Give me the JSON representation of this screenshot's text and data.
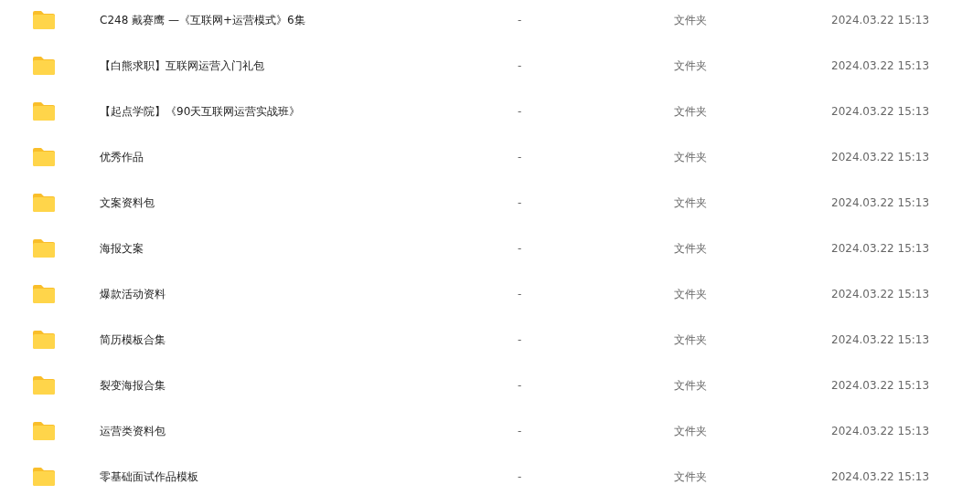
{
  "files": [
    {
      "name": "C248 戴赛鹰 —《互联网+运营模式》6集",
      "size": "-",
      "type": "文件夹",
      "modified": "2024.03.22 15:13"
    },
    {
      "name": "【白熊求职】互联网运营入门礼包",
      "size": "-",
      "type": "文件夹",
      "modified": "2024.03.22 15:13"
    },
    {
      "name": "【起点学院】《90天互联网运营实战班》",
      "size": "-",
      "type": "文件夹",
      "modified": "2024.03.22 15:13"
    },
    {
      "name": "优秀作品",
      "size": "-",
      "type": "文件夹",
      "modified": "2024.03.22 15:13"
    },
    {
      "name": "文案资料包",
      "size": "-",
      "type": "文件夹",
      "modified": "2024.03.22 15:13"
    },
    {
      "name": "海报文案",
      "size": "-",
      "type": "文件夹",
      "modified": "2024.03.22 15:13"
    },
    {
      "name": "爆款活动资料",
      "size": "-",
      "type": "文件夹",
      "modified": "2024.03.22 15:13"
    },
    {
      "name": "简历模板合集",
      "size": "-",
      "type": "文件夹",
      "modified": "2024.03.22 15:13"
    },
    {
      "name": "裂变海报合集",
      "size": "-",
      "type": "文件夹",
      "modified": "2024.03.22 15:13"
    },
    {
      "name": "运营类资料包",
      "size": "-",
      "type": "文件夹",
      "modified": "2024.03.22 15:13"
    },
    {
      "name": "零基础面试作品模板",
      "size": "-",
      "type": "文件夹",
      "modified": "2024.03.22 15:13"
    }
  ]
}
